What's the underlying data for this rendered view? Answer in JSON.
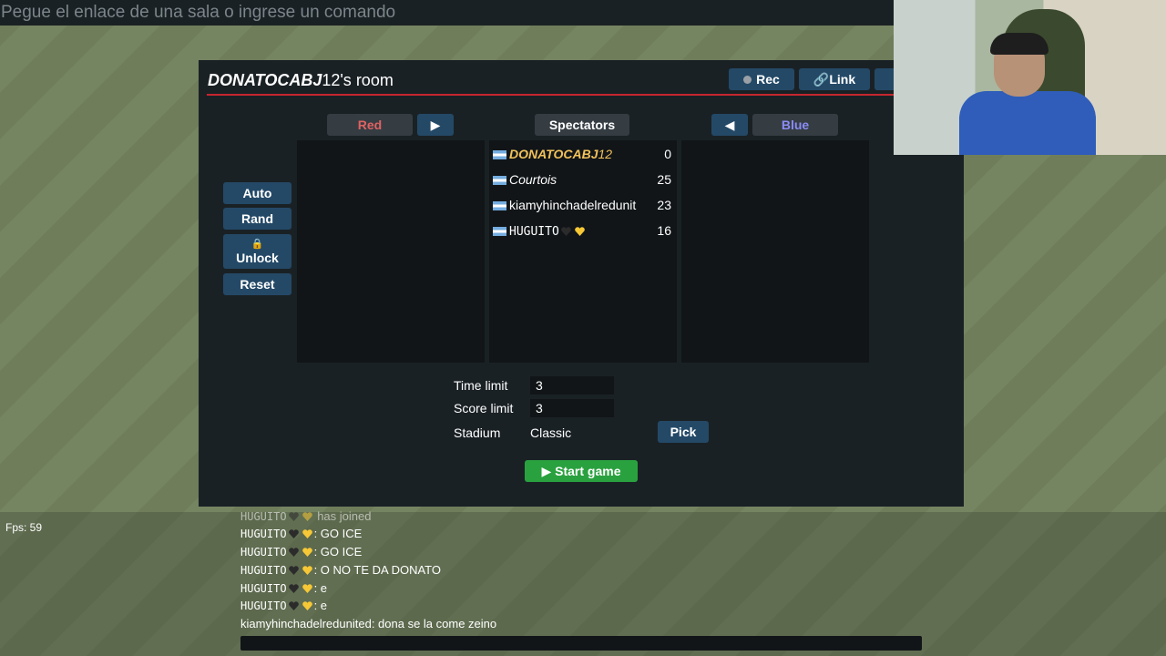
{
  "command_bar": {
    "placeholder": "Pegue el enlace de una sala o ingrese un comando"
  },
  "room": {
    "owner": "DONATOCABJ",
    "owner_suffix": "12",
    "title_rest": "'s room",
    "buttons": {
      "rec": "Rec",
      "link": "Link"
    },
    "teams": {
      "red": {
        "label": "Red",
        "move_icon": "▶"
      },
      "spectators": {
        "label": "Spectators"
      },
      "blue": {
        "label": "Blue",
        "move_icon": "◀"
      }
    },
    "side_buttons": {
      "auto": "Auto",
      "rand": "Rand",
      "unlock": "Unlock",
      "reset": "Reset"
    },
    "spectators": [
      {
        "name_a": "DONATOCABJ",
        "name_b": "12",
        "score": "0"
      },
      {
        "name": "Courtois",
        "score": "25"
      },
      {
        "name": "kiamyhinchadelredunit",
        "score": "23"
      },
      {
        "name": "HUGUITO",
        "score": "16"
      }
    ],
    "settings": {
      "time_limit_label": "Time limit",
      "time_limit": "3",
      "score_limit_label": "Score limit",
      "score_limit": "3",
      "stadium_label": "Stadium",
      "stadium": "Classic",
      "pick_label": "Pick"
    },
    "start_label": "Start game"
  },
  "fps": "Fps: 59",
  "chat": [
    {
      "name": "HUGUITO",
      "msg": " has joined"
    },
    {
      "name": "HUGUITO",
      "msg": ": GO ICE"
    },
    {
      "name": "HUGUITO",
      "msg": ": GO ICE"
    },
    {
      "name": "HUGUITO",
      "msg": ": O NO TE DA DONATO"
    },
    {
      "name": "HUGUITO",
      "msg": ": e"
    },
    {
      "name": "HUGUITO",
      "msg": ": e"
    },
    {
      "plain": "kiamyhinchadelredunited: dona se la come zeino"
    }
  ],
  "colors": {
    "panel": "#1a2125",
    "button": "#244967",
    "red_team": "#e06262",
    "blue_team": "#8b8cf5",
    "start": "#2aa13f"
  }
}
